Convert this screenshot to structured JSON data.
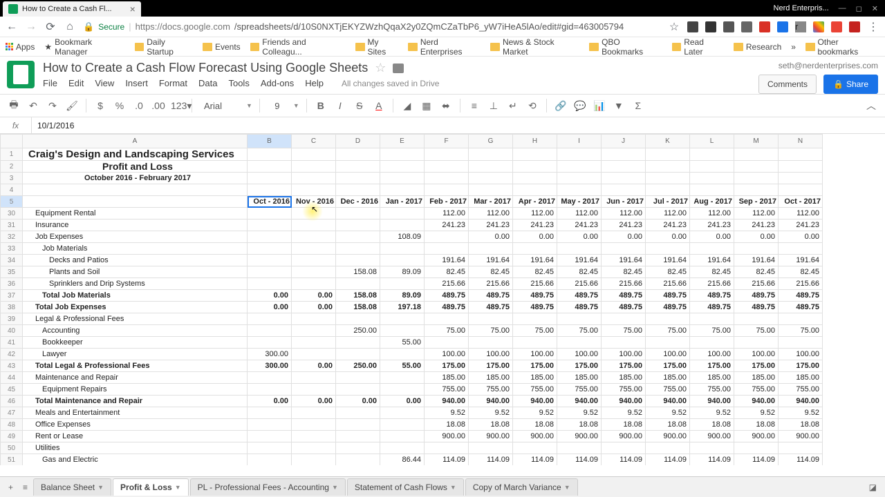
{
  "browser": {
    "tab_title": "How to Create a Cash Fl...",
    "profile": "Nerd Enterpris...",
    "secure": "Secure",
    "url_host": "https://docs.google.com",
    "url_path": "/spreadsheets/d/10S0NXTjEKYZWzhQqaX2y0ZQmCZaTbP6_yW7iHeA5lAo/edit#gid=463005794",
    "bookmarks": [
      "Apps",
      "Bookmark Manager",
      "Daily Startup",
      "Events",
      "Friends and Colleagu...",
      "My Sites",
      "Nerd Enterprises",
      "News & Stock Market",
      "QBO Bookmarks",
      "Read Later",
      "Research",
      "Other bookmarks"
    ]
  },
  "doc": {
    "title": "How to Create a Cash Flow Forecast Using Google Sheets",
    "user": "seth@nerdenterprises.com",
    "menus": [
      "File",
      "Edit",
      "View",
      "Insert",
      "Format",
      "Data",
      "Tools",
      "Add-ons",
      "Help"
    ],
    "saved": "All changes saved in Drive",
    "comments": "Comments",
    "share": "Share",
    "font": "Arial",
    "size": "9",
    "fx": "10/1/2016"
  },
  "columns": [
    "",
    "A",
    "B",
    "C",
    "D",
    "E",
    "F",
    "G",
    "H",
    "I",
    "J",
    "K",
    "L",
    "M",
    "N"
  ],
  "header_rows": {
    "r1": "Craig's Design and Landscaping Services",
    "r2": "Profit and Loss",
    "r3": "October 2016 - February 2017"
  },
  "months": [
    "Oct - 2016",
    "Nov - 2016",
    "Dec - 2016",
    "Jan - 2017",
    "Feb - 2017",
    "Mar - 2017",
    "Apr - 2017",
    "May - 2017",
    "Jun - 2017",
    "Jul - 2017",
    "Aug - 2017",
    "Sep - 2017",
    "Oct - 2017"
  ],
  "rows": [
    {
      "n": 30,
      "label": "Equipment Rental",
      "ind": 1,
      "v": [
        "",
        "",
        "",
        "",
        "112.00",
        "112.00",
        "112.00",
        "112.00",
        "112.00",
        "112.00",
        "112.00",
        "112.00",
        "112.00"
      ]
    },
    {
      "n": 31,
      "label": "Insurance",
      "ind": 1,
      "v": [
        "",
        "",
        "",
        "",
        "241.23",
        "241.23",
        "241.23",
        "241.23",
        "241.23",
        "241.23",
        "241.23",
        "241.23",
        "241.23"
      ]
    },
    {
      "n": 32,
      "label": "Job Expenses",
      "ind": 1,
      "v": [
        "",
        "",
        "",
        "108.09",
        "",
        "0.00",
        "0.00",
        "0.00",
        "0.00",
        "0.00",
        "0.00",
        "0.00",
        "0.00"
      ]
    },
    {
      "n": 33,
      "label": "Job Materials",
      "ind": 2,
      "v": [
        "",
        "",
        "",
        "",
        "",
        "",
        "",
        "",
        "",
        "",
        "",
        "",
        ""
      ]
    },
    {
      "n": 34,
      "label": "Decks and Patios",
      "ind": 3,
      "v": [
        "",
        "",
        "",
        "",
        "191.64",
        "191.64",
        "191.64",
        "191.64",
        "191.64",
        "191.64",
        "191.64",
        "191.64",
        "191.64"
      ]
    },
    {
      "n": 35,
      "label": "Plants and Soil",
      "ind": 3,
      "v": [
        "",
        "",
        "158.08",
        "89.09",
        "82.45",
        "82.45",
        "82.45",
        "82.45",
        "82.45",
        "82.45",
        "82.45",
        "82.45",
        "82.45"
      ]
    },
    {
      "n": 36,
      "label": "Sprinklers and Drip Systems",
      "ind": 3,
      "v": [
        "",
        "",
        "",
        "",
        "215.66",
        "215.66",
        "215.66",
        "215.66",
        "215.66",
        "215.66",
        "215.66",
        "215.66",
        "215.66"
      ]
    },
    {
      "n": 37,
      "label": "Total Job Materials",
      "ind": 2,
      "total": true,
      "v": [
        "0.00",
        "0.00",
        "158.08",
        "89.09",
        "489.75",
        "489.75",
        "489.75",
        "489.75",
        "489.75",
        "489.75",
        "489.75",
        "489.75",
        "489.75"
      ]
    },
    {
      "n": 38,
      "label": "Total Job Expenses",
      "ind": 1,
      "total": true,
      "v": [
        "0.00",
        "0.00",
        "158.08",
        "197.18",
        "489.75",
        "489.75",
        "489.75",
        "489.75",
        "489.75",
        "489.75",
        "489.75",
        "489.75",
        "489.75"
      ]
    },
    {
      "n": 39,
      "label": "Legal & Professional Fees",
      "ind": 1,
      "v": [
        "",
        "",
        "",
        "",
        "",
        "",
        "",
        "",
        "",
        "",
        "",
        "",
        ""
      ]
    },
    {
      "n": 40,
      "label": "Accounting",
      "ind": 2,
      "v": [
        "",
        "",
        "250.00",
        "",
        "75.00",
        "75.00",
        "75.00",
        "75.00",
        "75.00",
        "75.00",
        "75.00",
        "75.00",
        "75.00"
      ]
    },
    {
      "n": 41,
      "label": "Bookkeeper",
      "ind": 2,
      "v": [
        "",
        "",
        "",
        "55.00",
        "",
        "",
        "",
        "",
        "",
        "",
        "",
        "",
        ""
      ]
    },
    {
      "n": 42,
      "label": "Lawyer",
      "ind": 2,
      "v": [
        "300.00",
        "",
        "",
        "",
        "100.00",
        "100.00",
        "100.00",
        "100.00",
        "100.00",
        "100.00",
        "100.00",
        "100.00",
        "100.00"
      ]
    },
    {
      "n": 43,
      "label": "Total Legal & Professional Fees",
      "ind": 1,
      "total": true,
      "v": [
        "300.00",
        "0.00",
        "250.00",
        "55.00",
        "175.00",
        "175.00",
        "175.00",
        "175.00",
        "175.00",
        "175.00",
        "175.00",
        "175.00",
        "175.00"
      ]
    },
    {
      "n": 44,
      "label": "Maintenance and Repair",
      "ind": 1,
      "v": [
        "",
        "",
        "",
        "",
        "185.00",
        "185.00",
        "185.00",
        "185.00",
        "185.00",
        "185.00",
        "185.00",
        "185.00",
        "185.00"
      ]
    },
    {
      "n": 45,
      "label": "Equipment Repairs",
      "ind": 2,
      "v": [
        "",
        "",
        "",
        "",
        "755.00",
        "755.00",
        "755.00",
        "755.00",
        "755.00",
        "755.00",
        "755.00",
        "755.00",
        "755.00"
      ]
    },
    {
      "n": 46,
      "label": "Total Maintenance and Repair",
      "ind": 1,
      "total": true,
      "v": [
        "0.00",
        "0.00",
        "0.00",
        "0.00",
        "940.00",
        "940.00",
        "940.00",
        "940.00",
        "940.00",
        "940.00",
        "940.00",
        "940.00",
        "940.00"
      ]
    },
    {
      "n": 47,
      "label": "Meals and Entertainment",
      "ind": 1,
      "v": [
        "",
        "",
        "",
        "",
        "9.52",
        "9.52",
        "9.52",
        "9.52",
        "9.52",
        "9.52",
        "9.52",
        "9.52",
        "9.52"
      ]
    },
    {
      "n": 48,
      "label": "Office Expenses",
      "ind": 1,
      "v": [
        "",
        "",
        "",
        "",
        "18.08",
        "18.08",
        "18.08",
        "18.08",
        "18.08",
        "18.08",
        "18.08",
        "18.08",
        "18.08"
      ]
    },
    {
      "n": 49,
      "label": "Rent or Lease",
      "ind": 1,
      "v": [
        "",
        "",
        "",
        "",
        "900.00",
        "900.00",
        "900.00",
        "900.00",
        "900.00",
        "900.00",
        "900.00",
        "900.00",
        "900.00"
      ]
    },
    {
      "n": 50,
      "label": "Utilities",
      "ind": 1,
      "v": [
        "",
        "",
        "",
        "",
        "",
        "",
        "",
        "",
        "",
        "",
        "",
        "",
        ""
      ]
    },
    {
      "n": 51,
      "label": "Gas and Electric",
      "ind": 2,
      "v": [
        "",
        "",
        "",
        "86.44",
        "114.09",
        "114.09",
        "114.09",
        "114.09",
        "114.09",
        "114.09",
        "114.09",
        "114.09",
        "114.09"
      ]
    }
  ],
  "sheets": [
    "Balance Sheet",
    "Profit & Loss",
    "PL - Professional Fees - Accounting",
    "Statement of Cash Flows",
    "Copy of March Variance"
  ],
  "active_sheet": 1
}
